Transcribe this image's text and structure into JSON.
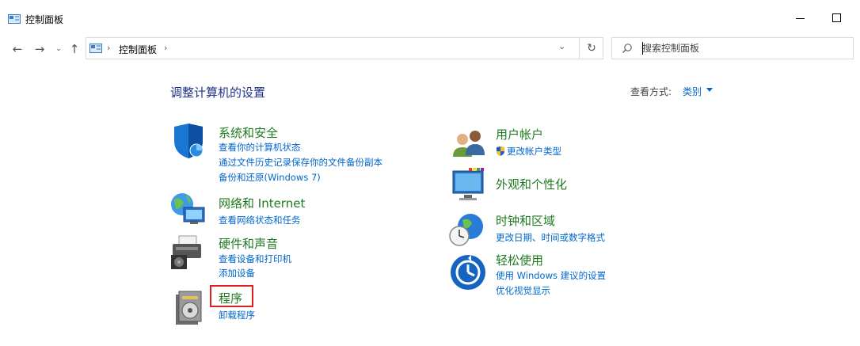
{
  "window": {
    "title": "控制面板"
  },
  "address": {
    "path": [
      "控制面板"
    ]
  },
  "search": {
    "placeholder": "搜索控制面板"
  },
  "page": {
    "heading": "调整计算机的设置",
    "view_by_label": "查看方式:",
    "view_by_value": "类别"
  },
  "categories": [
    {
      "title": "系统和安全",
      "links": [
        "查看你的计算机状态",
        "通过文件历史记录保存你的文件备份副本",
        "备份和还原(Windows 7)"
      ]
    },
    {
      "title": "网络和 Internet",
      "links": [
        "查看网络状态和任务"
      ]
    },
    {
      "title": "硬件和声音",
      "links": [
        "查看设备和打印机",
        "添加设备"
      ]
    },
    {
      "title": "程序",
      "links": [
        "卸载程序"
      ]
    },
    {
      "title": "用户帐户",
      "links": [
        "更改帐户类型"
      ]
    },
    {
      "title": "外观和个性化",
      "links": []
    },
    {
      "title": "时钟和区域",
      "links": [
        "更改日期、时间或数字格式"
      ]
    },
    {
      "title": "轻松使用",
      "links": [
        "使用 Windows 建议的设置",
        "优化视觉显示"
      ]
    }
  ],
  "colors": {
    "heading": "#1e3287",
    "category_title": "#1e7a1e",
    "link": "#0066cc",
    "highlight": "#e0201c"
  }
}
